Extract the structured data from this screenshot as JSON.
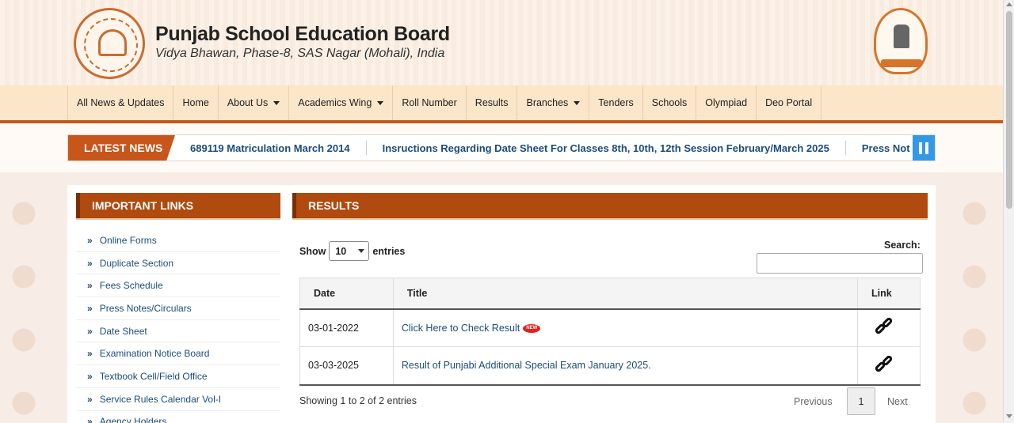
{
  "header": {
    "title": "Punjab School Education Board",
    "subtitle": "Vidya Bhawan, Phase-8, SAS Nagar (Mohali), India",
    "logo_icon": "pseb-logo-icon",
    "emblem_icon": "punjab-govt-emblem-icon"
  },
  "nav": {
    "items": [
      {
        "label": "All News & Updates",
        "dropdown": false
      },
      {
        "label": "Home",
        "dropdown": false
      },
      {
        "label": "About Us",
        "dropdown": true
      },
      {
        "label": "Academics Wing",
        "dropdown": true
      },
      {
        "label": "Roll Number",
        "dropdown": false
      },
      {
        "label": "Results",
        "dropdown": false
      },
      {
        "label": "Branches",
        "dropdown": true
      },
      {
        "label": "Tenders",
        "dropdown": false
      },
      {
        "label": "Schools",
        "dropdown": false
      },
      {
        "label": "Olympiad",
        "dropdown": false
      },
      {
        "label": "Deo Portal",
        "dropdown": false
      }
    ]
  },
  "news": {
    "label": "LATEST NEWS",
    "items": [
      "689119 Matriculation March 2014",
      "Insructions Regarding Date Sheet For Classes 8th, 10th, 12th Session February/March 2025",
      "Press Not"
    ]
  },
  "important_links": {
    "heading": "IMPORTANT LINKS",
    "items": [
      "Online Forms",
      "Duplicate Section",
      "Fees Schedule",
      "Press Notes/Circulars",
      "Date Sheet",
      "Examination Notice Board",
      "Textbook Cell/Field Office",
      "Service Rules Calendar Vol-I",
      "Agency Holders"
    ]
  },
  "results": {
    "heading": "RESULTS",
    "show_label": "Show",
    "entries_label": "entries",
    "page_size": "10",
    "search_label": "Search:",
    "columns": [
      "Date",
      "Title",
      "Link"
    ],
    "rows": [
      {
        "date": "03-01-2022",
        "title": "Click Here to Check Result",
        "badge": "NEW"
      },
      {
        "date": "03-03-2025",
        "title": "Result of Punjabi Additional Special Exam January 2025."
      }
    ],
    "info": "Showing 1 to 2 of 2 entries",
    "pager": {
      "previous": "Previous",
      "current": "1",
      "next": "Next"
    }
  },
  "colors": {
    "accent": "#c8561b",
    "panel_head": "#b04a0f",
    "link": "#1a4c7a",
    "pause_button": "#3399e6",
    "new_badge": "#e62020"
  }
}
